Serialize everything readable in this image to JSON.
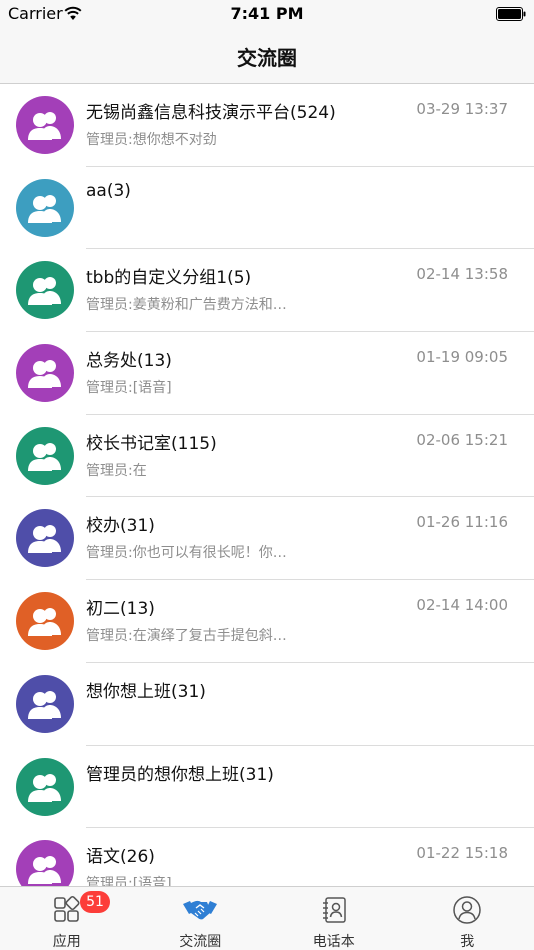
{
  "status_bar": {
    "carrier": "Carrier",
    "time": "7:41 PM"
  },
  "header": {
    "title": "交流圈"
  },
  "conversations": [
    {
      "name": "无锡尚鑫信息科技演示平台(524)",
      "time": "03-29 13:37",
      "message": "管理员:想你想不对劲",
      "avatar_color": "#a33fb8"
    },
    {
      "name": "aa(3)",
      "time": "",
      "message": "",
      "avatar_color": "#3d9ec0"
    },
    {
      "name": "tbb的自定义分组1(5)",
      "time": "02-14 13:58",
      "message": "管理员:姜黄粉和广告费方法和…",
      "avatar_color": "#1e9773"
    },
    {
      "name": "总务处(13)",
      "time": "01-19 09:05",
      "message": "管理员:[语音]",
      "avatar_color": "#a33fb8"
    },
    {
      "name": "校长书记室(115)",
      "time": "02-06 15:21",
      "message": "管理员:在",
      "avatar_color": "#1e9773"
    },
    {
      "name": "校办(31)",
      "time": "01-26 11:16",
      "message": "管理员:你也可以有很长呢！你…",
      "avatar_color": "#4f4ea9"
    },
    {
      "name": "初二(13)",
      "time": "02-14 14:00",
      "message": "管理员:在演绎了复古手提包斜…",
      "avatar_color": "#e06026"
    },
    {
      "name": "想你想上班(31)",
      "time": "",
      "message": "",
      "avatar_color": "#4f4ea9"
    },
    {
      "name": "管理员的想你想上班(31)",
      "time": "",
      "message": "",
      "avatar_color": "#1e9773"
    },
    {
      "name": "语文(26)",
      "time": "01-22 15:18",
      "message": "管理员:[语音]",
      "avatar_color": "#a33fb8"
    }
  ],
  "tabs": [
    {
      "label": "应用",
      "icon": "apps-grid-icon",
      "badge": "51",
      "active": false
    },
    {
      "label": "交流圈",
      "icon": "handshake-icon",
      "active": true
    },
    {
      "label": "电话本",
      "icon": "contact-book-icon",
      "active": false
    },
    {
      "label": "我",
      "icon": "profile-icon",
      "active": false
    }
  ],
  "colors": {
    "active_tab": "#2f7fd4",
    "inactive_tab": "#555555",
    "badge": "#fc3d39"
  }
}
